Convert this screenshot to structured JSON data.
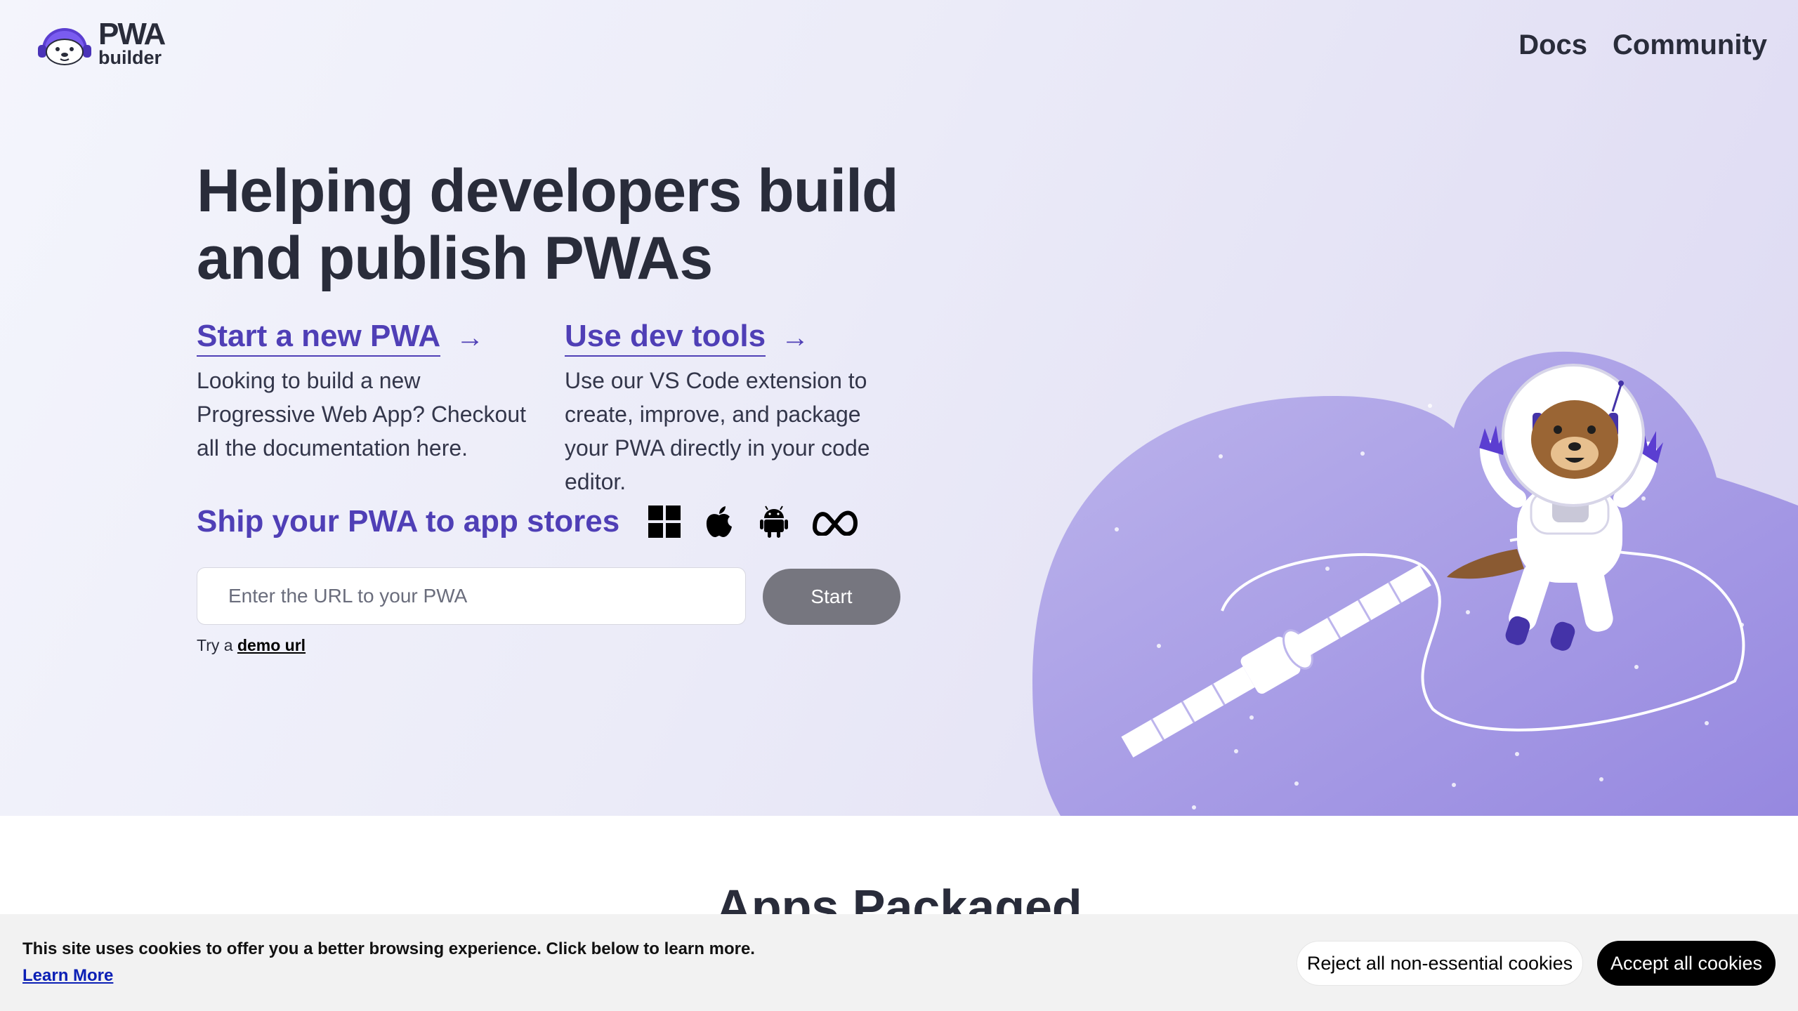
{
  "logo": {
    "line1": "PWA",
    "line2": "builder"
  },
  "nav": {
    "docs": "Docs",
    "community": "Community"
  },
  "hero": {
    "headline": "Helping developers build and publish PWAs",
    "col1": {
      "title": "Start a new PWA",
      "arrow": "→",
      "description": "Looking to build a new Progressive Web App? Checkout all the documentation here."
    },
    "col2": {
      "title": "Use dev tools",
      "arrow": "→",
      "description": "Use our VS Code extension to create, improve, and package your PWA directly in your code editor."
    },
    "ship_text": "Ship your PWA to app stores",
    "store_icons": [
      "windows-icon",
      "apple-icon",
      "android-icon",
      "meta-icon"
    ],
    "url_placeholder": "Enter the URL to your PWA",
    "url_value": "",
    "start_label": "Start",
    "try_prefix": "Try a",
    "demo_link": "demo url"
  },
  "apps_section": {
    "title": "Apps Packaged"
  },
  "cookie_banner": {
    "message": "This site uses cookies to offer you a better browsing experience. Click below to learn more.",
    "learn_more": "Learn More",
    "reject": "Reject all non-essential cookies",
    "accept": "Accept all cookies"
  },
  "colors": {
    "accent": "#4f3fb6",
    "heading": "#292c3a",
    "start_button": "#76767f",
    "illustration_purple": "#a99fe6"
  }
}
